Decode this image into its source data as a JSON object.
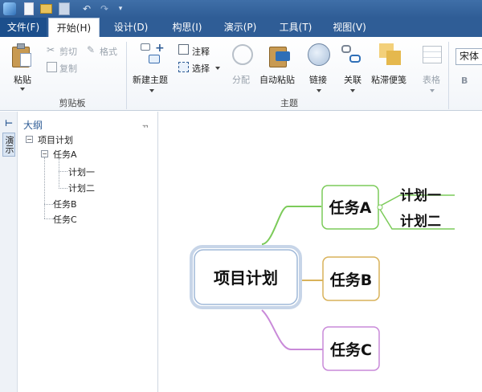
{
  "quick_access": {
    "app_icon": "app-logo-icon",
    "new_icon": "new-file-icon",
    "open_icon": "open-folder-icon",
    "save_icon": "save-icon",
    "undo_icon": "undo-icon",
    "redo_icon": "redo-icon",
    "customize_icon": "customize-icon"
  },
  "menu": {
    "file": "文件(F)",
    "start": "开始(H)",
    "design": "设计(D)",
    "idea": "构思(I)",
    "present": "演示(P)",
    "tools": "工具(T)",
    "view": "视图(V)"
  },
  "ribbon": {
    "clipboard": {
      "paste": "粘贴",
      "cut": "剪切",
      "copy": "复制",
      "format": "格式",
      "group_label": "剪贴板"
    },
    "topic": {
      "new_topic": "新建主题",
      "note": "注释",
      "select": "选择",
      "split": "分配",
      "auto_paste": "自动粘贴",
      "link": "链接",
      "relate": "关联",
      "sticky": "粘滞便笺",
      "table": "表格",
      "group_label": "主题"
    },
    "font": {
      "name": "宋体",
      "bold": "B"
    }
  },
  "side_strip": {
    "outline_tab": "大纲",
    "present_tab": "演示"
  },
  "outline": {
    "title": "大纲",
    "pin_icon": "pin-icon",
    "root": "项目计划",
    "task_a": "任务A",
    "plan_1": "计划一",
    "plan_2": "计划二",
    "task_b": "任务B",
    "task_c": "任务C"
  },
  "mindmap": {
    "central": "项目计划",
    "task_a": "任务A",
    "task_b": "任务B",
    "task_c": "任务C",
    "plan_1": "计划一",
    "plan_2": "计划二",
    "colors": {
      "task_a": "#7ccb5a",
      "task_b": "#d9b25a",
      "task_c": "#c98ad9",
      "plan": "#7ccb5a",
      "central_border": "#9fb8d8"
    }
  }
}
